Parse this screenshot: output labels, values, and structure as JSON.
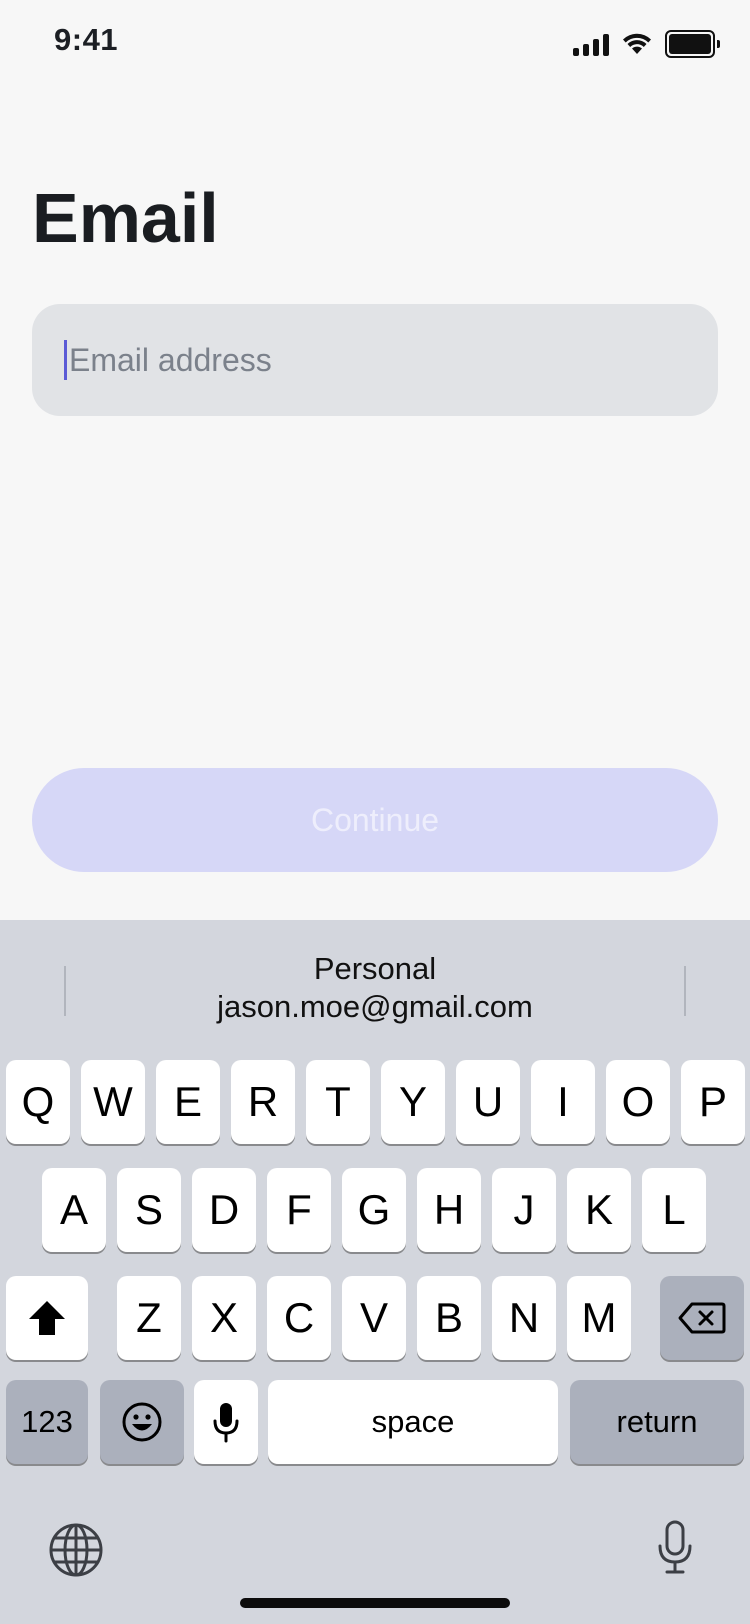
{
  "status_bar": {
    "time": "9:41"
  },
  "page": {
    "title": "Email"
  },
  "email_field": {
    "value": "",
    "placeholder": "Email address"
  },
  "continue_button": {
    "label": "Continue"
  },
  "keyboard": {
    "suggestion": {
      "line1": "Personal",
      "line2": "jason.moe@gmail.com"
    },
    "row1": [
      "Q",
      "W",
      "E",
      "R",
      "T",
      "Y",
      "U",
      "I",
      "O",
      "P"
    ],
    "row2": [
      "A",
      "S",
      "D",
      "F",
      "G",
      "H",
      "J",
      "K",
      "L"
    ],
    "row3": [
      "Z",
      "X",
      "C",
      "V",
      "B",
      "N",
      "M"
    ],
    "numbers_label": "123",
    "space_label": "space",
    "return_label": "return"
  },
  "colors": {
    "background": "#f7f7f7",
    "input_bg": "#e1e3e6",
    "accent_caret": "#5b5bd6",
    "button_disabled": "#d6d7f7",
    "keyboard_bg": "#d3d6dd"
  }
}
